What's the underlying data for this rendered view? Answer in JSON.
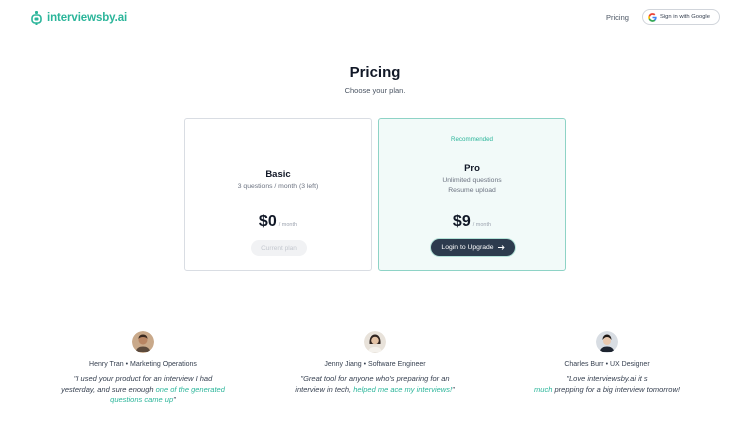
{
  "header": {
    "brand": "interviewsby.ai",
    "nav_pricing": "Pricing",
    "signin_label": "Sign in with Google"
  },
  "page": {
    "title": "Pricing",
    "subtitle": "Choose your plan."
  },
  "plans": [
    {
      "name": "Basic",
      "desc_lines": [
        "3 questions / month (3 left)"
      ],
      "price": "$0",
      "period": "/ month",
      "button": "Current plan"
    },
    {
      "badge": "Recommended",
      "name": "Pro",
      "desc_lines": [
        "Unlimited questions",
        "Resume upload"
      ],
      "price": "$9",
      "period": "/ month",
      "button": "Login to Upgrade"
    }
  ],
  "testimonials": [
    {
      "name": "Henry Tran • Marketing Operations",
      "quote_lines": [
        [
          "\"I used your product for an interview I had",
          ""
        ],
        [
          "yesterday, and sure enough ",
          "one of the generated"
        ],
        [
          "",
          "questions came up"
        ],
        [
          "\"",
          ""
        ]
      ]
    },
    {
      "name": "Jenny Jiang • Software Engineer",
      "quote_lines": [
        [
          "\"Great tool for anyone who's preparing for an",
          ""
        ],
        [
          "interview in tech, ",
          "helped me ace my interviews!"
        ],
        [
          "\"",
          ""
        ]
      ]
    },
    {
      "name": "Charles Burr • UX Designer",
      "quote_lines": [
        [
          "\"Love interviewsby.ai it s",
          ""
        ],
        [
          "",
          "much"
        ],
        [
          " prepping for a big interview tomorrow!",
          ""
        ]
      ]
    }
  ],
  "colors": {
    "brand": "#2bb59a",
    "pro_card_bg": "#f2faf9",
    "pro_card_border": "#8ed3c6",
    "upgrade_button": "#2d3b4e"
  },
  "icons": {
    "brand_logo": "robot-mic-icon",
    "google": "google-g-icon",
    "upgrade_arrow": "arrow-right-icon"
  }
}
